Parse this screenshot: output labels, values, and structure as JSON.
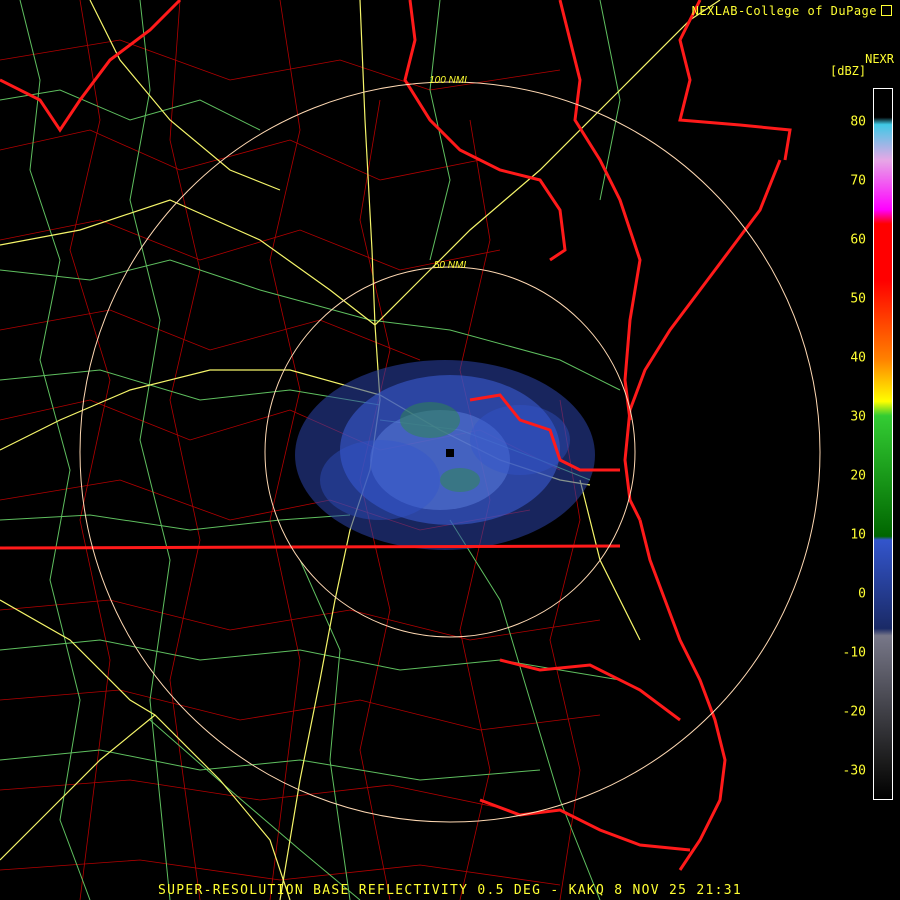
{
  "credit": "NEXLAB-College of DuPage",
  "product": "NEXR",
  "units": "[dBZ]",
  "footer": "SUPER-RESOLUTION BASE REFLECTIVITY 0.5 DEG - KAKQ 8 NOV 25 21:31",
  "range_rings": [
    "50 NMI",
    "100 NMI"
  ],
  "scale": {
    "ticks": [
      "80",
      "70",
      "60",
      "50",
      "40",
      "30",
      "20",
      "10",
      "0",
      "-10",
      "-20",
      "-30"
    ],
    "colors": {
      "cyan": "#3fc9e6",
      "purple_light": "#e6a8e6",
      "magenta": "#ff00ff",
      "red": "#ff0000",
      "orange": "#ff8000",
      "yellow": "#ffff00",
      "green": "#33cc33",
      "dark_green": "#006600",
      "blue": "#3355cc",
      "navy": "#1a2a66",
      "gray": "#777788",
      "black": "#000000"
    }
  },
  "map_colors": {
    "state_border": "#ff0000",
    "county_border": "#cc0000",
    "highway": "#ffff66",
    "road": "#66cc66",
    "range_ring": "#ffe0c0"
  }
}
